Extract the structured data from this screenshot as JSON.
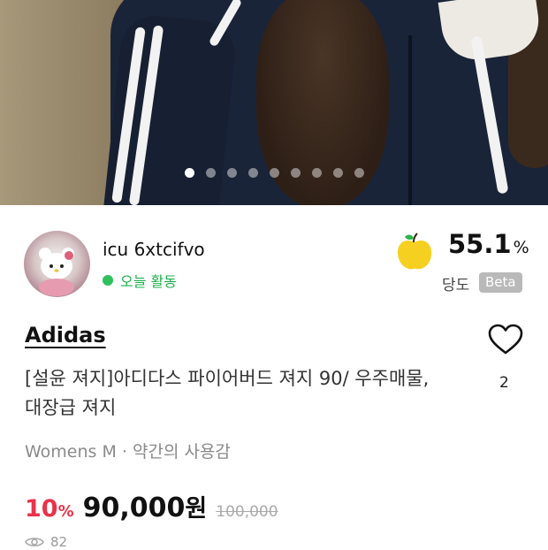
{
  "carousel": {
    "count": 9,
    "active_index": 0
  },
  "seller": {
    "name": "icu 6xtcifvo",
    "activity": "오늘 활동"
  },
  "sweetness": {
    "value": "55.1",
    "unit": "%",
    "label": "당도",
    "badge": "Beta"
  },
  "product": {
    "brand": "Adidas",
    "title": "[설윤 져지]아디다스 파이어버드 져지 90/ 우주매물,대장급 져지",
    "meta": "Womens M · 약간의 사용감",
    "like_count": "2",
    "discount": "10",
    "discount_unit": "%",
    "price": "90,000",
    "price_unit": "원",
    "original_price": "100,000",
    "views": "82"
  },
  "colors": {
    "accent_red": "#e8334a",
    "active_green": "#2fc05a",
    "apple_yellow": "#f5d020"
  },
  "icons": [
    "apple-icon",
    "heart-icon",
    "eye-icon",
    "green-dot"
  ]
}
